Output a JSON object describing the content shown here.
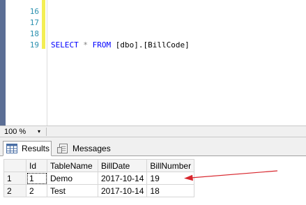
{
  "editor": {
    "line_numbers": [
      "16",
      "17",
      "17",
      "18",
      "19"
    ],
    "code": {
      "select": "SELECT",
      "star": "*",
      "from": "FROM",
      "table": "[dbo].[BillCode]"
    }
  },
  "zoom": {
    "value": "100 %",
    "caret": "▾"
  },
  "tabs": [
    {
      "label": "Results",
      "icon": "grid-icon",
      "active": true
    },
    {
      "label": "Messages",
      "icon": "messages-icon",
      "active": false
    }
  ],
  "grid": {
    "columns": [
      "",
      "Id",
      "TableName",
      "BillDate",
      "BillNumber"
    ],
    "rows": [
      [
        "1",
        "1",
        "Demo",
        "2017-10-14",
        "19"
      ],
      [
        "2",
        "2",
        "Test",
        "2017-10-14",
        "18"
      ]
    ]
  },
  "colors": {
    "keyword": "#0000ff",
    "line_number": "#2b91af",
    "change_bar": "#f3ee54",
    "annotation_arrow": "#d8262d"
  }
}
